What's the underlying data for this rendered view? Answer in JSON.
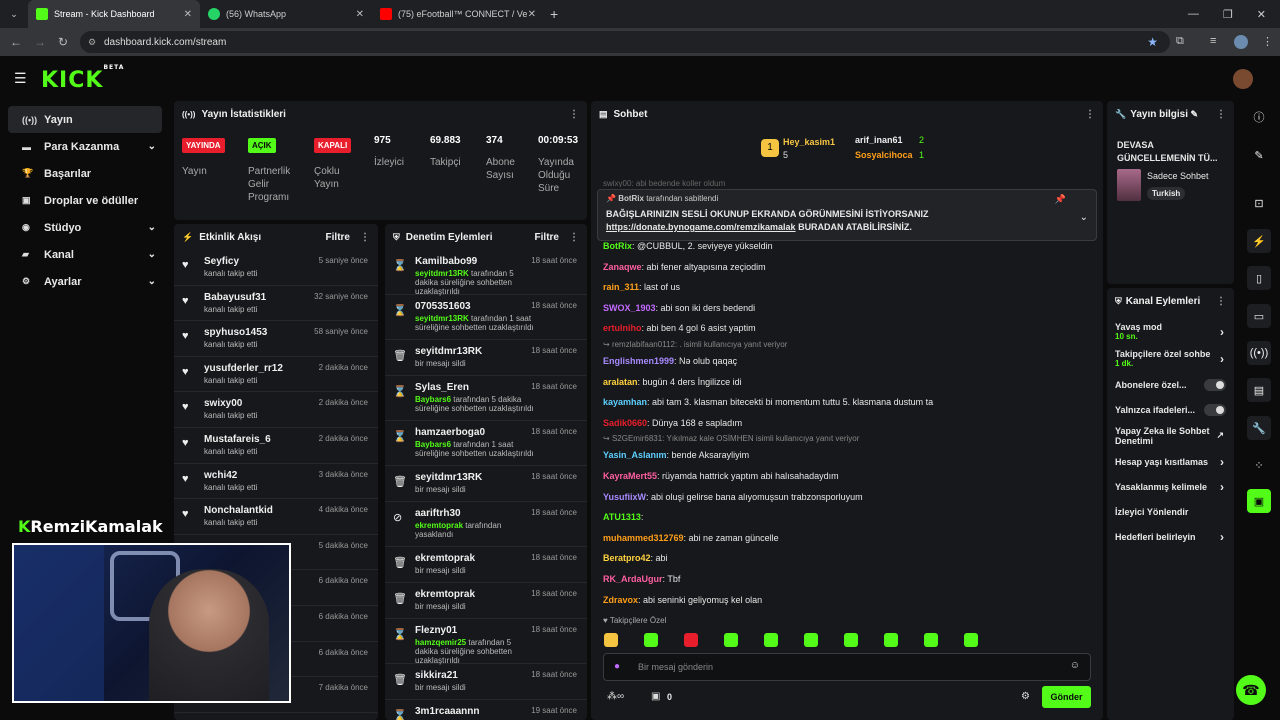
{
  "browser": {
    "tabs": [
      {
        "title": "Stream - Kick Dashboard",
        "color": "#53fc18",
        "active": true
      },
      {
        "title": "(56) WhatsApp",
        "color": "#25d366",
        "active": false
      },
      {
        "title": "(75) eFootball™ CONNECT / Ve",
        "color": "#ff0000",
        "active": false
      }
    ],
    "url": "dashboard.kick.com/stream"
  },
  "header": {
    "logo": "KICK",
    "logo_sup": "BETA"
  },
  "sidebar": {
    "items": [
      {
        "label": "Yayın",
        "icon": "broadcast-icon",
        "active": true,
        "chev": false
      },
      {
        "label": "Para Kazanma",
        "icon": "money-icon",
        "active": false,
        "chev": true
      },
      {
        "label": "Başarılar",
        "icon": "trophy-icon",
        "active": false,
        "chev": false
      },
      {
        "label": "Droplar ve ödüller",
        "icon": "gift-icon",
        "active": false,
        "chev": false
      },
      {
        "label": "Stüdyo",
        "icon": "studio-icon",
        "active": false,
        "chev": true
      },
      {
        "label": "Kanal",
        "icon": "channel-icon",
        "active": false,
        "chev": true
      },
      {
        "label": "Ayarlar",
        "icon": "settings-icon",
        "active": false,
        "chev": true
      }
    ]
  },
  "stats": {
    "title": "Yayın İstatistikleri",
    "badges": [
      {
        "badge": "YAYINDA",
        "label": "Yayın",
        "color": "#e91e2c"
      },
      {
        "badge": "AÇIK",
        "label": "Partnerlik Gelir Programı",
        "color": "#53fc18"
      },
      {
        "badge": "KAPALI",
        "label": "Çoklu Yayın",
        "color": "#e91e2c"
      }
    ],
    "numbers": [
      {
        "value": "975",
        "label": "İzleyici"
      },
      {
        "value": "69.883",
        "label": "Takipçi"
      },
      {
        "value": "374",
        "label": "Abone Sayısı"
      },
      {
        "value": "00:09:53",
        "label": "Yayında Olduğu Süre"
      }
    ]
  },
  "activity": {
    "title": "Etkinlik Akışı",
    "filter": "Filtre",
    "items": [
      {
        "name": "Seyficy",
        "sub": "kanalı takip etti",
        "time": "5 saniye önce"
      },
      {
        "name": "Babayusuf31",
        "sub": "kanalı takip etti",
        "time": "32 saniye önce"
      },
      {
        "name": "spyhuso1453",
        "sub": "kanalı takip etti",
        "time": "58 saniye önce"
      },
      {
        "name": "yusufderler_rr12",
        "sub": "kanalı takip etti",
        "time": "2 dakika önce"
      },
      {
        "name": "swixy00",
        "sub": "kanalı takip etti",
        "time": "2 dakika önce"
      },
      {
        "name": "Mustafareis_6",
        "sub": "kanalı takip etti",
        "time": "2 dakika önce"
      },
      {
        "name": "wchi42",
        "sub": "kanalı takip etti",
        "time": "3 dakika önce"
      },
      {
        "name": "Nonchalantkid",
        "sub": "kanalı takip etti",
        "time": "4 dakika önce"
      },
      {
        "name": "",
        "sub": "",
        "time": "5 dakika önce"
      },
      {
        "name": "",
        "sub": "",
        "time": "6 dakika önce"
      },
      {
        "name": "",
        "sub": "",
        "time": "6 dakika önce"
      },
      {
        "name": "",
        "sub": "",
        "time": "6 dakika önce"
      },
      {
        "name": "",
        "sub": "kanalı takip etti",
        "time": "7 dakika önce"
      }
    ]
  },
  "moderation": {
    "title": "Denetim Eylemleri",
    "filter": "Filtre",
    "items": [
      {
        "name": "Kamilbabo99",
        "actor": "seyitdmr13RK",
        "sub": " tarafından 5 dakika süreliğine sohbetten uzaklaştırıldı",
        "time": "18 saat önce",
        "icon": "hourglass-icon"
      },
      {
        "name": "0705351603",
        "actor": "seyitdmr13RK",
        "sub": " tarafından 1 saat süreliğine sohbetten uzaklaştırıldı",
        "time": "18 saat önce",
        "icon": "hourglass-icon"
      },
      {
        "name": "seyitdmr13RK",
        "actor": "",
        "sub": "bir mesajı sildi",
        "time": "18 saat önce",
        "icon": "trash-icon"
      },
      {
        "name": "Sylas_Eren",
        "actor": "Baybars6",
        "sub": " tarafından 5 dakika süreliğine sohbetten uzaklaştırıldı",
        "time": "18 saat önce",
        "icon": "hourglass-icon"
      },
      {
        "name": "hamzaerboga0",
        "actor": "Baybars6",
        "sub": " tarafından 1 saat süreliğine sohbetten uzaklaştırıldı",
        "time": "18 saat önce",
        "icon": "hourglass-icon"
      },
      {
        "name": "seyitdmr13RK",
        "actor": "",
        "sub": "bir mesajı sildi",
        "time": "18 saat önce",
        "icon": "trash-icon"
      },
      {
        "name": "aariftrh30",
        "actor": "ekremtoprak",
        "sub": " tarafından yasaklandı",
        "time": "18 saat önce",
        "icon": "ban-icon"
      },
      {
        "name": "ekremtoprak",
        "actor": "",
        "sub": "bir mesajı sildi",
        "time": "18 saat önce",
        "icon": "trash-icon"
      },
      {
        "name": "ekremtoprak",
        "actor": "",
        "sub": "bir mesajı sildi",
        "time": "18 saat önce",
        "icon": "trash-icon"
      },
      {
        "name": "Flezny01",
        "actor": "hamzqemir25",
        "sub": " tarafından 5 dakika süreliğine sohbetten uzaklaştırıldı",
        "time": "18 saat önce",
        "icon": "hourglass-icon"
      },
      {
        "name": "sikkira21",
        "actor": "",
        "sub": "bir mesajı sildi",
        "time": "18 saat önce",
        "icon": "trash-icon"
      },
      {
        "name": "3m1rcaaannn",
        "actor": "",
        "sub": "",
        "time": "19 saat önce",
        "icon": "hourglass-icon"
      }
    ]
  },
  "chat": {
    "title": "Sohbet",
    "top_gifters": [
      {
        "name": "Hey_kasim1",
        "count": "5"
      },
      {
        "name": "arif_inan61",
        "count": "2"
      },
      {
        "name": "Sosyalcihoca",
        "count": "1"
      }
    ],
    "pinned": {
      "by_user": "BotRix",
      "by_suffix": " tarafından sabitlendi",
      "text": "BAĞIŞLARINIZIN SESLİ OKUNUP EKRANDA GÖRÜNMESİNİ İSTİYORSANIZ",
      "link": "https://donate.bynogame.com/remzikamalak",
      "link_suffix": " BURADAN ATABİLİRSİNİZ."
    },
    "partial_top": "swixy00: abi bedende koller oldum",
    "messages": [
      {
        "user": "BotRix",
        "color": "#53fc18",
        "text": ": @CUBBUL, 2. seviyeye yükseldin"
      },
      {
        "user": "Zanaqwe",
        "color": "#ff5fa2",
        "text": ": abi fener altyapısına zeçiodim"
      },
      {
        "user": "rain_311",
        "color": "#ff9f1a",
        "text": ": last of us"
      },
      {
        "user": "SWOX_1903",
        "color": "#c26bff",
        "text": ": abi son iki ders bedendi"
      },
      {
        "user": "ertulniho",
        "color": "#e91e2c",
        "text": ": abi ben 4 gol 6 asist yaptim"
      },
      {
        "user": "Englishmen1999",
        "color": "#a78bff",
        "text": ": Nə olub qaqaç",
        "reply": "remzlabifaan0112: . isimli kullanıcıya yanıt veriyor"
      },
      {
        "user": "aralatan",
        "color": "#ffd23f",
        "text": ": bugün 4 ders İngilizce idi"
      },
      {
        "user": "kayamhan",
        "color": "#5dd0ff",
        "text": ": abi tam 3. klasman bitecekti bi momentum tuttu 5. klasmana dustum ta"
      },
      {
        "user": "Sadik0660",
        "color": "#e91e2c",
        "text": ": Dünya 168 e sapladım"
      },
      {
        "user": "Yasin_Aslanım",
        "color": "#5dd0ff",
        "text": ": bende Aksarayliyim",
        "reply": "S2GEmir6831: Yıkılmaz kale OSİMHEN isimli kullanıcıya yanıt veriyor"
      },
      {
        "user": "KayraMert55",
        "color": "#ff5fa2",
        "text": ": rüyamda hattrick yaptım abi halısahadaydım"
      },
      {
        "user": "YusufiixW",
        "color": "#a78bff",
        "text": ": abi oluşi gelirse bana alıyomuşsun trabzonsporluyum"
      },
      {
        "user": "ATU1313",
        "color": "#53fc18",
        "text": ":"
      },
      {
        "user": "muhammed312769",
        "color": "#ff9f1a",
        "text": ": abi ne zaman güncelle"
      },
      {
        "user": "Beratpro42",
        "color": "#ffd23f",
        "text": ": abi"
      },
      {
        "user": "RK_ArdaUgur",
        "color": "#ff5fa2",
        "text": ": Tbf"
      },
      {
        "user": "Zdravox",
        "color": "#ff9f1a",
        "text": ": abi seninki geliyomuş kel olan"
      }
    ],
    "followers_only": "Takipçilere Özel",
    "input_placeholder": "Bir mesaj gönderin",
    "count": "0",
    "send": "Gönder"
  },
  "stream_info": {
    "title": "Yayın bilgisi",
    "stream_title": "DEVASA GÜNCELLEMENİN TÜ...",
    "category": "Sadece Sohbet",
    "tag": "Turkish"
  },
  "channel_actions": {
    "title": "Kanal Eylemleri",
    "items": [
      {
        "label": "Yavaş mod",
        "value": "10 sn.",
        "kind": "chev"
      },
      {
        "label": "Takipçilere özel sohbe",
        "value": "1 dk.",
        "kind": "chev"
      },
      {
        "label": "Abonelere özel...",
        "value": "",
        "kind": "toggle"
      },
      {
        "label": "Yalnızca ifadeleri...",
        "value": "",
        "kind": "toggle"
      },
      {
        "label": "Yapay Zeka ile Sohbet Denetimi",
        "value": "",
        "kind": "ext"
      },
      {
        "label": "Hesap yaşı kısıtlamas",
        "value": "",
        "kind": "chev"
      },
      {
        "label": "Yasaklanmış kelimele",
        "value": "",
        "kind": "chev"
      },
      {
        "label": "İzleyici Yönlendir",
        "value": "",
        "kind": "none"
      },
      {
        "label": "Hedefleri belirleyin",
        "value": "",
        "kind": "chev"
      }
    ]
  },
  "overlay": {
    "streamer": "RemziKamalak"
  },
  "colors": {
    "accent": "#53fc18",
    "live": "#e91e2c",
    "panel": "#17181b"
  }
}
